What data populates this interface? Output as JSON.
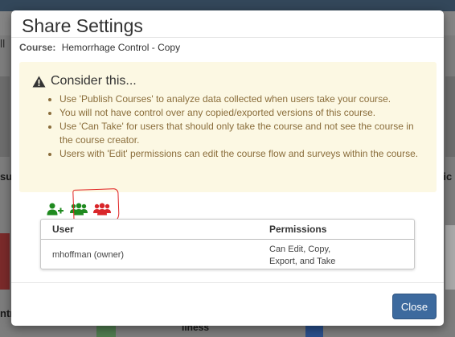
{
  "modal": {
    "title": "Share Settings",
    "course_label": "Course:",
    "course_name": "Hemorrhage Control - Copy"
  },
  "consider": {
    "title": "Consider this...",
    "items": [
      "Use 'Publish Courses' to analyze data collected when users take your course.",
      "You will not have control over any copied/exported versions of this course.",
      "Use 'Can Take' for users that should only take the course and not see the course in the course creator.",
      "Users with 'Edit' permissions can edit the course flow and surveys within the course."
    ]
  },
  "share_icons": [
    {
      "name": "add-user-icon",
      "color": "#1f8a1f"
    },
    {
      "name": "users-group-icon",
      "color": "#1f8a1f"
    },
    {
      "name": "users-group-icon",
      "color": "#d9262a"
    }
  ],
  "table": {
    "headers": [
      "User",
      "Permissions"
    ],
    "rows": [
      {
        "user": "mhoffman (owner)",
        "permissions": "Can Edit, Copy, Export, and Take"
      }
    ]
  },
  "footer": {
    "close_label": "Close"
  },
  "background": {
    "left_text": "ll",
    "edge_left_1": "su",
    "edge_right_1": "tic",
    "edge_left_2": "ntr",
    "bottom_text": "llness"
  },
  "colors": {
    "warning_bg": "#fcf8e3",
    "warning_text": "#8a6d3b",
    "primary_button": "#3d6a9e",
    "annotation": "#e02020"
  }
}
